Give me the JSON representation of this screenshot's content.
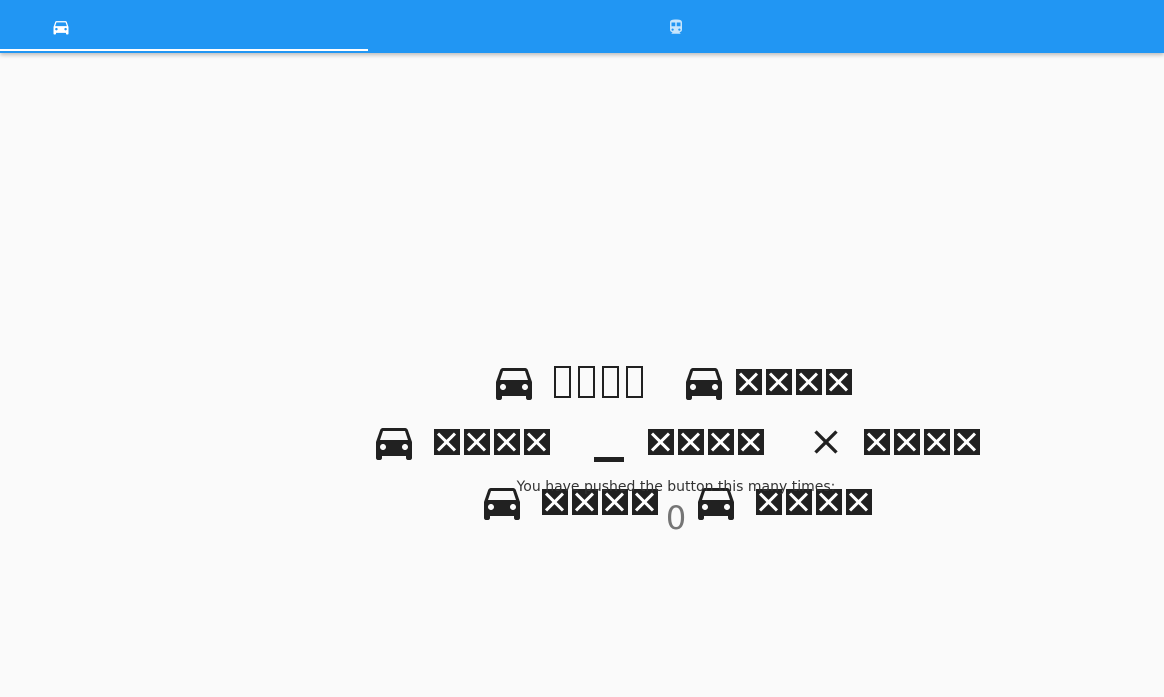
{
  "tabs": [
    {
      "icon": "directions-car-icon",
      "selected": true
    },
    {
      "icon": "directions-transit-icon",
      "selected": false
    }
  ],
  "colors": {
    "appbar": "#2196f3",
    "indicator": "#ffffff",
    "text": "#212121",
    "background": "#fafafa"
  },
  "main": {
    "caption": "You have pushed the button this many times:",
    "counter": "0"
  }
}
